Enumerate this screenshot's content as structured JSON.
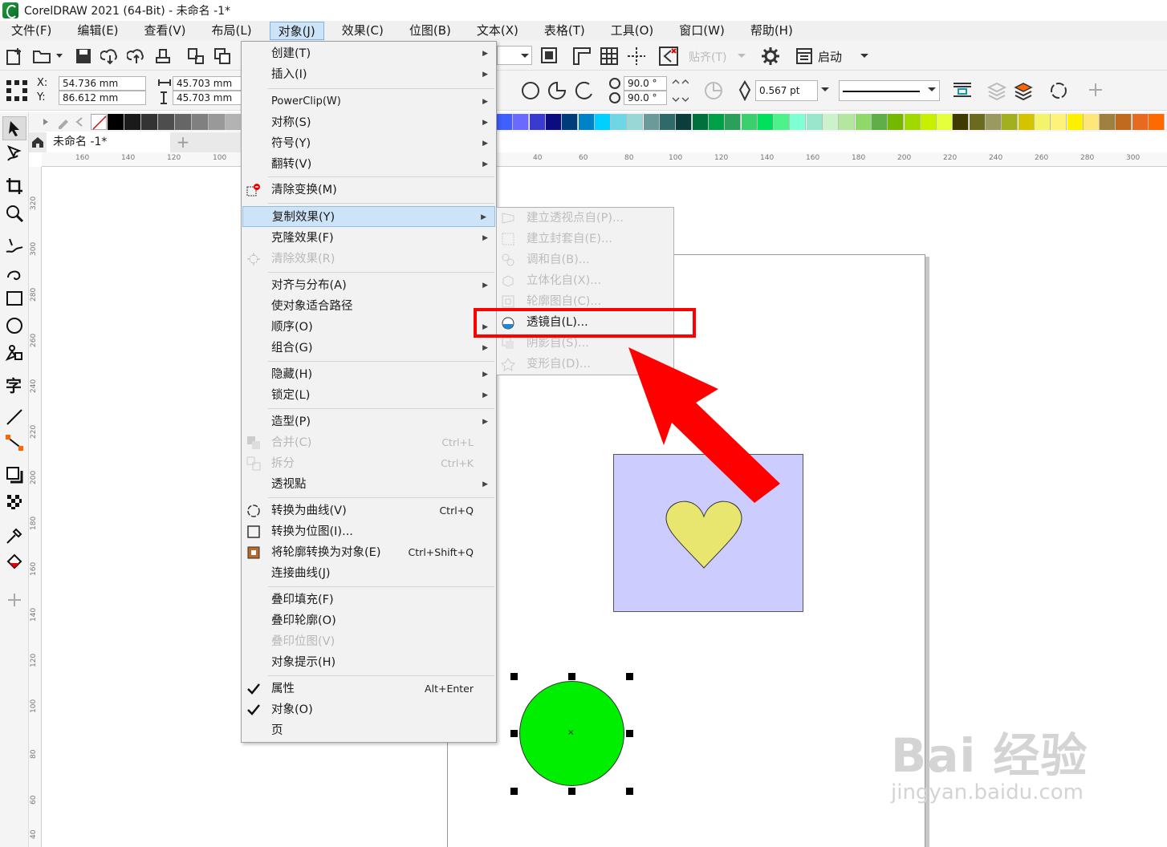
{
  "window": {
    "title": "CorelDRAW 2021 (64-Bit) - 未命名 -1*"
  },
  "menubar": [
    {
      "label": "文件(F)"
    },
    {
      "label": "编辑(E)"
    },
    {
      "label": "查看(V)"
    },
    {
      "label": "布局(L)"
    },
    {
      "label": "对象(J)"
    },
    {
      "label": "效果(C)"
    },
    {
      "label": "位图(B)"
    },
    {
      "label": "文本(X)"
    },
    {
      "label": "表格(T)"
    },
    {
      "label": "工具(O)"
    },
    {
      "label": "窗口(W)"
    },
    {
      "label": "帮助(H)"
    }
  ],
  "toolbar": {
    "snap_label": "贴齐(T)",
    "launch_label": "启动"
  },
  "propbar": {
    "x_label": "X:",
    "y_label": "Y:",
    "x_value": "54.736 mm",
    "y_value": "86.612 mm",
    "w_value": "45.703 mm",
    "h_value": "45.703 mm",
    "angle1": "90.0 °",
    "angle2": "90.0 °",
    "outline_width": "0.567 pt"
  },
  "tabs": {
    "document": "未命名 -1*",
    "add": "+"
  },
  "ruler_h": [
    "160",
    "140",
    "120",
    "100",
    "40",
    "60",
    "80",
    "100",
    "120",
    "140",
    "160",
    "180",
    "200",
    "220",
    "240",
    "260",
    "280",
    "300"
  ],
  "ruler_v": [
    "320",
    "300",
    "280",
    "260",
    "240",
    "220",
    "200",
    "180",
    "160",
    "140",
    "120",
    "100",
    "80",
    "60",
    "40"
  ],
  "object_menu": {
    "items": [
      {
        "label": "创建(T)",
        "submenu": true
      },
      {
        "label": "插入(I)",
        "submenu": true
      },
      {
        "label": "PowerClip(W)",
        "submenu": true
      },
      {
        "label": "对称(S)",
        "submenu": true
      },
      {
        "label": "符号(Y)",
        "submenu": true
      },
      {
        "label": "翻转(V)",
        "submenu": true
      },
      {
        "label": "清除变换(M)"
      },
      {
        "label": "复制效果(Y)",
        "submenu": true
      },
      {
        "label": "克隆效果(F)",
        "submenu": true
      },
      {
        "label": "清除效果(R)"
      },
      {
        "label": "对齐与分布(A)",
        "submenu": true
      },
      {
        "label": "使对象适合路径"
      },
      {
        "label": "顺序(O)",
        "submenu": true
      },
      {
        "label": "组合(G)",
        "submenu": true
      },
      {
        "label": "隐藏(H)",
        "submenu": true
      },
      {
        "label": "锁定(L)",
        "submenu": true
      },
      {
        "label": "造型(P)",
        "submenu": true
      },
      {
        "label": "合并(C)",
        "shortcut": "Ctrl+L"
      },
      {
        "label": "拆分",
        "shortcut": "Ctrl+K"
      },
      {
        "label": "透视點",
        "submenu": true
      },
      {
        "label": "转换为曲线(V)",
        "shortcut": "Ctrl+Q"
      },
      {
        "label": "转换为位图(I)..."
      },
      {
        "label": "将轮廓转换为对象(E)",
        "shortcut": "Ctrl+Shift+Q"
      },
      {
        "label": "连接曲线(J)"
      },
      {
        "label": "叠印填充(F)"
      },
      {
        "label": "叠印轮廓(O)"
      },
      {
        "label": "叠印位图(V)"
      },
      {
        "label": "对象提示(H)"
      },
      {
        "label": "属性",
        "shortcut": "Alt+Enter",
        "checked": true
      },
      {
        "label": "对象(O)",
        "checked": true
      },
      {
        "label": "页"
      }
    ]
  },
  "copy_effect_submenu": {
    "items": [
      {
        "label": "建立透视点自(P)..."
      },
      {
        "label": "建立封套自(E)..."
      },
      {
        "label": "调和自(B)..."
      },
      {
        "label": "立体化自(X)..."
      },
      {
        "label": "轮廓图自(C)..."
      },
      {
        "label": "透镜自(L)..."
      },
      {
        "label": "阴影自(S)..."
      },
      {
        "label": "变形自(D)..."
      }
    ]
  },
  "colors": {
    "highlight": "#ff0000",
    "rect_fill": "#ccccff",
    "heart_fill": "#e8e66e",
    "circle_fill": "#00ee00"
  },
  "watermark": {
    "main": "Bai 经验",
    "sub": "jingyan.baidu.com"
  }
}
